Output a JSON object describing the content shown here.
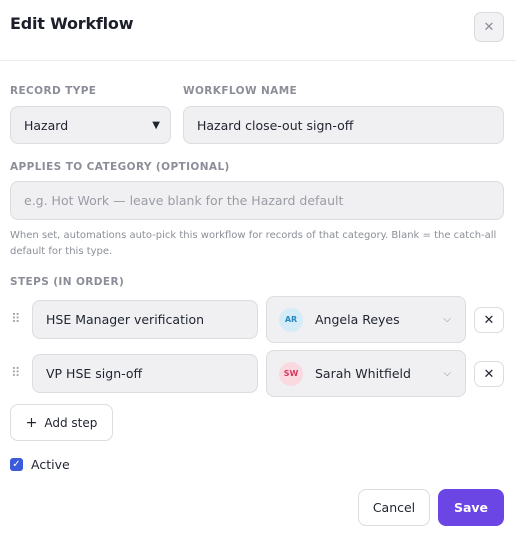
{
  "dialog": {
    "title": "Edit Workflow",
    "close_icon": "close-icon"
  },
  "record_type": {
    "label": "RECORD TYPE",
    "value": "Hazard"
  },
  "workflow_name": {
    "label": "WORKFLOW NAME",
    "value": "Hazard close-out sign-off"
  },
  "category": {
    "label": "APPLIES TO CATEGORY (OPTIONAL)",
    "value": "",
    "placeholder": "e.g. Hot Work — leave blank for the Hazard default",
    "help": "When set, automations auto-pick this workflow for records of that category. Blank = the catch-all default for this type."
  },
  "steps": {
    "label": "STEPS (IN ORDER)",
    "items": [
      {
        "name": "HSE Manager verification",
        "assignee": {
          "initials": "AR",
          "name": "Angela Reyes",
          "avatar_bg": "#d4ecf7",
          "avatar_fg": "#2a8ac0"
        }
      },
      {
        "name": "VP HSE sign-off",
        "assignee": {
          "initials": "SW",
          "name": "Sarah Whitfield",
          "avatar_bg": "#fbd9e1",
          "avatar_fg": "#d23b5e"
        }
      }
    ],
    "add_label": "Add step"
  },
  "active": {
    "label": "Active",
    "checked": true
  },
  "footer": {
    "cancel_label": "Cancel",
    "save_label": "Save"
  },
  "colors": {
    "accent": "#6b46e5",
    "checkbox": "#3b5bdb"
  }
}
